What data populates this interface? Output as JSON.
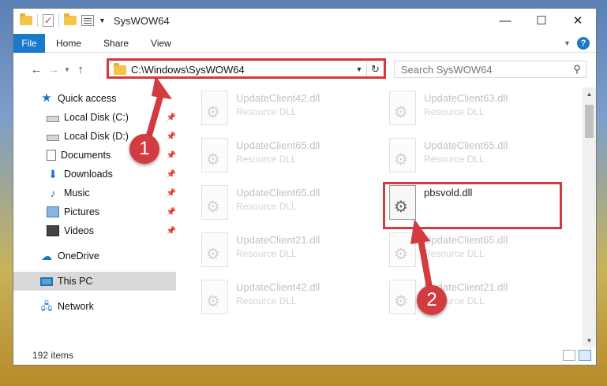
{
  "window": {
    "title": "SysWOW64",
    "minimize_glyph": "—",
    "maximize_glyph": "☐",
    "close_glyph": "✕"
  },
  "ribbon": {
    "tabs": [
      "File",
      "Home",
      "Share",
      "View"
    ],
    "help_glyph": "?"
  },
  "navigation": {
    "address": "C:\\Windows\\SysWOW64",
    "search_placeholder": "Search SysWOW64"
  },
  "sidebar": {
    "items": [
      {
        "label": "Quick access",
        "icon": "quick-access-star-icon"
      },
      {
        "label": "Local Disk (C:)",
        "icon": "drive-icon",
        "pinned": true
      },
      {
        "label": "Local Disk (D:)",
        "icon": "drive-icon",
        "pinned": true
      },
      {
        "label": "Documents",
        "icon": "documents-icon",
        "pinned": true
      },
      {
        "label": "Downloads",
        "icon": "downloads-icon",
        "pinned": true
      },
      {
        "label": "Music",
        "icon": "music-icon",
        "pinned": true
      },
      {
        "label": "Pictures",
        "icon": "pictures-icon",
        "pinned": true
      },
      {
        "label": "Videos",
        "icon": "videos-icon",
        "pinned": true
      },
      {
        "label": "OneDrive",
        "icon": "onedrive-icon"
      },
      {
        "label": "This PC",
        "icon": "this-pc-icon",
        "selected": true
      },
      {
        "label": "Network",
        "icon": "network-icon"
      }
    ]
  },
  "files": [
    {
      "name": "UpdateClient42.dll",
      "type": "Resource DLL",
      "faded": true
    },
    {
      "name": "UpdateClient63.dll",
      "type": "Resource DLL",
      "faded": true
    },
    {
      "name": "UpdateClient65.dll",
      "type": "Resource DLL",
      "faded": true
    },
    {
      "name": "UpdateClient65.dll",
      "type": "Resource DLL",
      "faded": true
    },
    {
      "name": "UpdateClient65.dll",
      "type": "Resource DLL",
      "faded": true
    },
    {
      "name": "pbsvold.dll",
      "type": "",
      "faded": false,
      "highlighted": true
    },
    {
      "name": "UpdateClient21.dll",
      "type": "Resource DLL",
      "faded": true
    },
    {
      "name": "UpdateClient65.dll",
      "type": "Resource DLL",
      "faded": true
    },
    {
      "name": "UpdateClient42.dll",
      "type": "Resource DLL",
      "faded": true
    },
    {
      "name": "UpdateClient21.dll",
      "type": "Resource DLL",
      "faded": true
    }
  ],
  "status": {
    "item_count": "192 items"
  },
  "annotations": {
    "callout_1": "1",
    "callout_2": "2",
    "highlight_color": "#d23b3f"
  }
}
